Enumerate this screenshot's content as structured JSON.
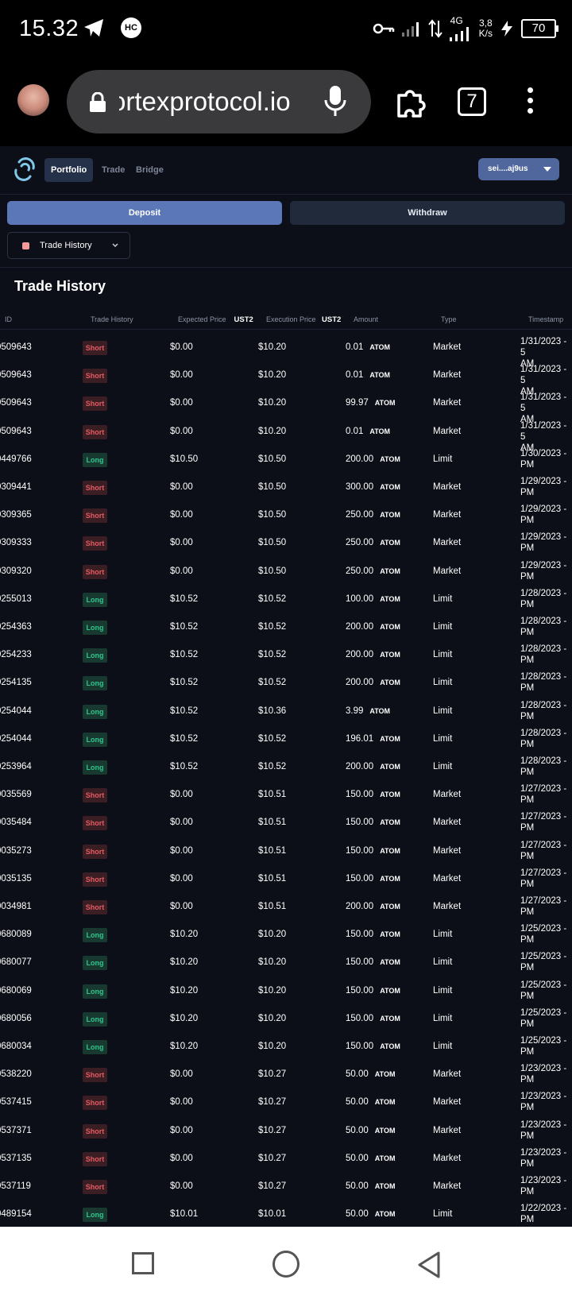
{
  "status_bar": {
    "time": "15.32",
    "hc_badge": "HC",
    "network": "4G",
    "speed_value": "3,8",
    "speed_unit": "K/s",
    "battery": "70"
  },
  "browser": {
    "url_visible": "ortexprotocol.io",
    "tab_count": "7"
  },
  "app": {
    "nav": {
      "portfolio": "Portfolio",
      "trade": "Trade",
      "bridge": "Bridge",
      "wallet": "sei....aj9us"
    },
    "deposit_label": "Deposit",
    "withdraw_label": "Withdraw",
    "dropdown_label": "Trade History",
    "section_title": "Trade History",
    "columns": {
      "id": "ID",
      "trade_history": "Trade History",
      "expected_price": "Expected Price",
      "expected_unit": "UST2",
      "execution_price": "Execution Price",
      "execution_unit": "UST2",
      "amount": "Amount",
      "type": "Type",
      "timestamp": "Timestamp"
    },
    "rows": [
      {
        "id": "0509643",
        "side": "Short",
        "exp": "$0.00",
        "exe": "$10.20",
        "amt": "0.01",
        "asset": "ATOM",
        "type": "Market",
        "ts1": "1/31/2023 - 5",
        "ts2": "AM"
      },
      {
        "id": "0509643",
        "side": "Short",
        "exp": "$0.00",
        "exe": "$10.20",
        "amt": "0.01",
        "asset": "ATOM",
        "type": "Market",
        "ts1": "1/31/2023 - 5",
        "ts2": "AM"
      },
      {
        "id": "0509643",
        "side": "Short",
        "exp": "$0.00",
        "exe": "$10.20",
        "amt": "99.97",
        "asset": "ATOM",
        "type": "Market",
        "ts1": "1/31/2023 - 5",
        "ts2": "AM"
      },
      {
        "id": "0509643",
        "side": "Short",
        "exp": "$0.00",
        "exe": "$10.20",
        "amt": "0.01",
        "asset": "ATOM",
        "type": "Market",
        "ts1": "1/31/2023 - 5",
        "ts2": "AM"
      },
      {
        "id": "0449766",
        "side": "Long",
        "exp": "$10.50",
        "exe": "$10.50",
        "amt": "200.00",
        "asset": "ATOM",
        "type": "Limit",
        "ts1": "1/30/2023 -",
        "ts2": "PM"
      },
      {
        "id": "0309441",
        "side": "Short",
        "exp": "$0.00",
        "exe": "$10.50",
        "amt": "300.00",
        "asset": "ATOM",
        "type": "Market",
        "ts1": "1/29/2023 -",
        "ts2": "PM"
      },
      {
        "id": "0309365",
        "side": "Short",
        "exp": "$0.00",
        "exe": "$10.50",
        "amt": "250.00",
        "asset": "ATOM",
        "type": "Market",
        "ts1": "1/29/2023 -",
        "ts2": "PM"
      },
      {
        "id": "0309333",
        "side": "Short",
        "exp": "$0.00",
        "exe": "$10.50",
        "amt": "250.00",
        "asset": "ATOM",
        "type": "Market",
        "ts1": "1/29/2023 -",
        "ts2": "PM"
      },
      {
        "id": "0309320",
        "side": "Short",
        "exp": "$0.00",
        "exe": "$10.50",
        "amt": "250.00",
        "asset": "ATOM",
        "type": "Market",
        "ts1": "1/29/2023 -",
        "ts2": "PM"
      },
      {
        "id": "0255013",
        "side": "Long",
        "exp": "$10.52",
        "exe": "$10.52",
        "amt": "100.00",
        "asset": "ATOM",
        "type": "Limit",
        "ts1": "1/28/2023 -",
        "ts2": "PM"
      },
      {
        "id": "0254363",
        "side": "Long",
        "exp": "$10.52",
        "exe": "$10.52",
        "amt": "200.00",
        "asset": "ATOM",
        "type": "Limit",
        "ts1": "1/28/2023 -",
        "ts2": "PM"
      },
      {
        "id": "0254233",
        "side": "Long",
        "exp": "$10.52",
        "exe": "$10.52",
        "amt": "200.00",
        "asset": "ATOM",
        "type": "Limit",
        "ts1": "1/28/2023 -",
        "ts2": "PM"
      },
      {
        "id": "0254135",
        "side": "Long",
        "exp": "$10.52",
        "exe": "$10.52",
        "amt": "200.00",
        "asset": "ATOM",
        "type": "Limit",
        "ts1": "1/28/2023 -",
        "ts2": "PM"
      },
      {
        "id": "0254044",
        "side": "Long",
        "exp": "$10.52",
        "exe": "$10.36",
        "amt": "3.99",
        "asset": "ATOM",
        "type": "Limit",
        "ts1": "1/28/2023 -",
        "ts2": "PM"
      },
      {
        "id": "0254044",
        "side": "Long",
        "exp": "$10.52",
        "exe": "$10.52",
        "amt": "196.01",
        "asset": "ATOM",
        "type": "Limit",
        "ts1": "1/28/2023 -",
        "ts2": "PM"
      },
      {
        "id": "0253964",
        "side": "Long",
        "exp": "$10.52",
        "exe": "$10.52",
        "amt": "200.00",
        "asset": "ATOM",
        "type": "Limit",
        "ts1": "1/28/2023 -",
        "ts2": "PM"
      },
      {
        "id": "0035569",
        "side": "Short",
        "exp": "$0.00",
        "exe": "$10.51",
        "amt": "150.00",
        "asset": "ATOM",
        "type": "Market",
        "ts1": "1/27/2023 -",
        "ts2": "PM"
      },
      {
        "id": "0035484",
        "side": "Short",
        "exp": "$0.00",
        "exe": "$10.51",
        "amt": "150.00",
        "asset": "ATOM",
        "type": "Market",
        "ts1": "1/27/2023 -",
        "ts2": "PM"
      },
      {
        "id": "0035273",
        "side": "Short",
        "exp": "$0.00",
        "exe": "$10.51",
        "amt": "150.00",
        "asset": "ATOM",
        "type": "Market",
        "ts1": "1/27/2023 -",
        "ts2": "PM"
      },
      {
        "id": "0035135",
        "side": "Short",
        "exp": "$0.00",
        "exe": "$10.51",
        "amt": "150.00",
        "asset": "ATOM",
        "type": "Market",
        "ts1": "1/27/2023 -",
        "ts2": "PM"
      },
      {
        "id": "0034981",
        "side": "Short",
        "exp": "$0.00",
        "exe": "$10.51",
        "amt": "200.00",
        "asset": "ATOM",
        "type": "Market",
        "ts1": "1/27/2023 -",
        "ts2": "PM"
      },
      {
        "id": "0680089",
        "side": "Long",
        "exp": "$10.20",
        "exe": "$10.20",
        "amt": "150.00",
        "asset": "ATOM",
        "type": "Limit",
        "ts1": "1/25/2023 -",
        "ts2": "PM"
      },
      {
        "id": "0680077",
        "side": "Long",
        "exp": "$10.20",
        "exe": "$10.20",
        "amt": "150.00",
        "asset": "ATOM",
        "type": "Limit",
        "ts1": "1/25/2023 -",
        "ts2": "PM"
      },
      {
        "id": "0680069",
        "side": "Long",
        "exp": "$10.20",
        "exe": "$10.20",
        "amt": "150.00",
        "asset": "ATOM",
        "type": "Limit",
        "ts1": "1/25/2023 -",
        "ts2": "PM"
      },
      {
        "id": "0680056",
        "side": "Long",
        "exp": "$10.20",
        "exe": "$10.20",
        "amt": "150.00",
        "asset": "ATOM",
        "type": "Limit",
        "ts1": "1/25/2023 -",
        "ts2": "PM"
      },
      {
        "id": "0680034",
        "side": "Long",
        "exp": "$10.20",
        "exe": "$10.20",
        "amt": "150.00",
        "asset": "ATOM",
        "type": "Limit",
        "ts1": "1/25/2023 -",
        "ts2": "PM"
      },
      {
        "id": "0538220",
        "side": "Short",
        "exp": "$0.00",
        "exe": "$10.27",
        "amt": "50.00",
        "asset": "ATOM",
        "type": "Market",
        "ts1": "1/23/2023 -",
        "ts2": "PM"
      },
      {
        "id": "0537415",
        "side": "Short",
        "exp": "$0.00",
        "exe": "$10.27",
        "amt": "50.00",
        "asset": "ATOM",
        "type": "Market",
        "ts1": "1/23/2023 -",
        "ts2": "PM"
      },
      {
        "id": "0537371",
        "side": "Short",
        "exp": "$0.00",
        "exe": "$10.27",
        "amt": "50.00",
        "asset": "ATOM",
        "type": "Market",
        "ts1": "1/23/2023 -",
        "ts2": "PM"
      },
      {
        "id": "0537135",
        "side": "Short",
        "exp": "$0.00",
        "exe": "$10.27",
        "amt": "50.00",
        "asset": "ATOM",
        "type": "Market",
        "ts1": "1/23/2023 -",
        "ts2": "PM"
      },
      {
        "id": "0537119",
        "side": "Short",
        "exp": "$0.00",
        "exe": "$10.27",
        "amt": "50.00",
        "asset": "ATOM",
        "type": "Market",
        "ts1": "1/23/2023 -",
        "ts2": "PM"
      },
      {
        "id": "0489154",
        "side": "Long",
        "exp": "$10.01",
        "exe": "$10.01",
        "amt": "50.00",
        "asset": "ATOM",
        "type": "Limit",
        "ts1": "1/22/2023 -",
        "ts2": "PM"
      }
    ]
  },
  "colors": {
    "app_bg": "#0c0f17",
    "accent": "#5b77b8",
    "short": "#e55b63",
    "long": "#31c48d"
  },
  "icons": [
    "telegram-icon",
    "key-icon",
    "signal-icon",
    "data-arrows-icon",
    "charging-icon",
    "lock-icon",
    "mic-icon",
    "extensions-icon",
    "more-icon",
    "app-logo-icon",
    "chevron-down-icon",
    "square-nav-icon",
    "circle-nav-icon",
    "back-nav-icon"
  ]
}
